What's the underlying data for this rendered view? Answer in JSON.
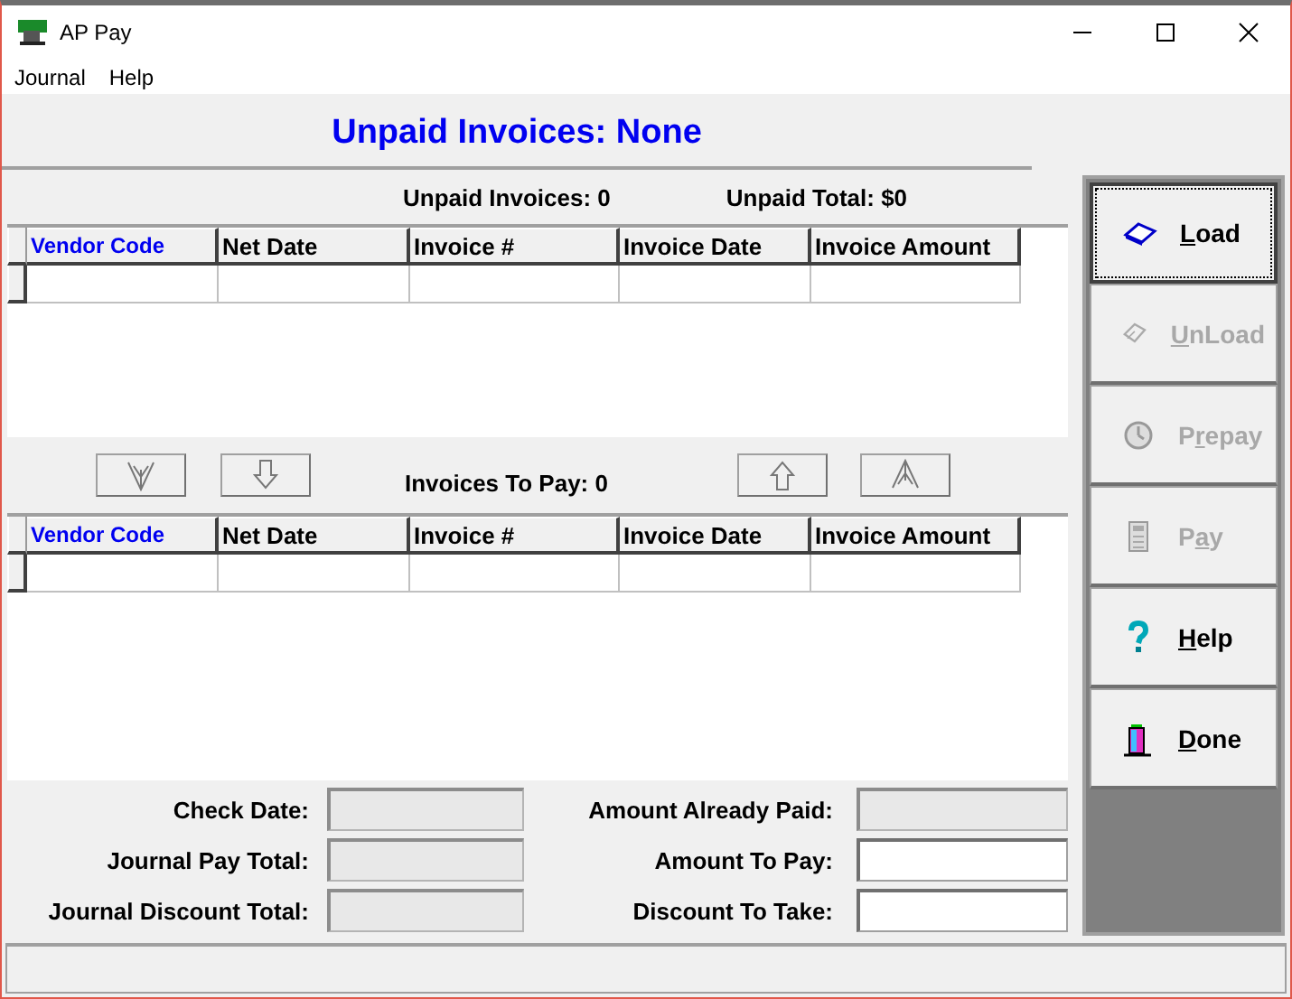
{
  "window": {
    "title": "AP Pay"
  },
  "menu": [
    {
      "label": "Journal"
    },
    {
      "label": "Help"
    }
  ],
  "heading": "Unpaid Invoices: None",
  "summary": {
    "count": "Unpaid Invoices: 0",
    "total": "Unpaid Total: $0"
  },
  "unpaid_table": {
    "columns": [
      {
        "label": "Vendor Code",
        "key": true
      },
      {
        "label": "Net Date",
        "key": false
      },
      {
        "label": "Invoice #",
        "key": false
      },
      {
        "label": "Invoice Date",
        "key": false
      },
      {
        "label": "Invoice Amount",
        "key": false
      }
    ]
  },
  "move_buttons": [
    {
      "kind": "all-down"
    },
    {
      "kind": "down"
    },
    {
      "kind": "up"
    },
    {
      "kind": "all-up"
    }
  ],
  "to_pay_label": "Invoices To Pay: 0",
  "to_pay_table": {
    "columns": [
      {
        "label": "Vendor Code",
        "key": true
      },
      {
        "label": "Net Date",
        "key": false
      },
      {
        "label": "Invoice #",
        "key": false
      },
      {
        "label": "Invoice Date",
        "key": false
      },
      {
        "label": "Invoice Amount",
        "key": false
      }
    ]
  },
  "fields_left": [
    {
      "label": "Check Date:",
      "disabled": true
    },
    {
      "label": "Journal Pay Total:",
      "disabled": true
    },
    {
      "label": "Journal Discount Total:",
      "disabled": true
    }
  ],
  "fields_right": [
    {
      "label": "Amount Already Paid:",
      "disabled": true
    },
    {
      "label": "Amount To Pay:",
      "disabled": false
    },
    {
      "label": "Discount To Take:",
      "disabled": false
    }
  ],
  "actions": [
    {
      "kind": "load",
      "key": "L",
      "post": "oad",
      "disabled": false,
      "focused": true
    },
    {
      "kind": "unload",
      "key": "U",
      "post": "nLoad",
      "disabled": true,
      "focused": false
    },
    {
      "kind": "prepay",
      "pre": "P",
      "key": "r",
      "post": "epay",
      "disabled": true,
      "focused": false
    },
    {
      "kind": "pay",
      "pre": "P",
      "key": "a",
      "post": "y",
      "disabled": true,
      "focused": false
    },
    {
      "kind": "help",
      "key": "H",
      "post": "elp",
      "disabled": false,
      "focused": false
    },
    {
      "kind": "done",
      "key": "D",
      "post": "one",
      "disabled": false,
      "focused": false
    }
  ]
}
